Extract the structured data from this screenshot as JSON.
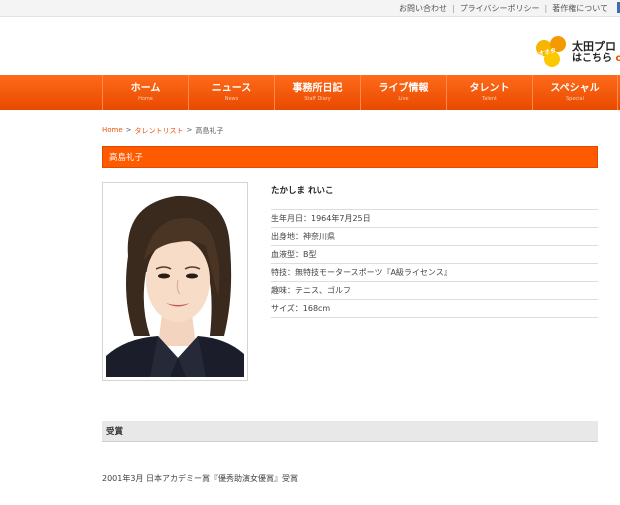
{
  "top_links": [
    "お問い合わせ",
    "プライバシーポリシー",
    "著作権について"
  ],
  "logo": {
    "mark_text": "オオタ",
    "line1": "太田プロ",
    "line2_main": "はこちら",
    "line2_accent": "oh"
  },
  "nav": [
    {
      "ja": "ホーム",
      "en": "Home"
    },
    {
      "ja": "ニュース",
      "en": "News"
    },
    {
      "ja": "事務所日記",
      "en": "Staff Diary"
    },
    {
      "ja": "ライブ情報",
      "en": "Live"
    },
    {
      "ja": "タレント",
      "en": "Talent"
    },
    {
      "ja": "スペシャル",
      "en": "Special"
    }
  ],
  "breadcrumb": {
    "home": "Home",
    "sep": ">",
    "list": "タレントリスト",
    "current": "高島礼子"
  },
  "title": "高島礼子",
  "profile": {
    "kana": "たかしま れいこ",
    "rows": [
      {
        "label": "生年月日：",
        "value": "1964年7月25日"
      },
      {
        "label": "出身地：",
        "value": "神奈川県"
      },
      {
        "label": "血液型：",
        "value": "B型"
      },
      {
        "label": "特技：",
        "value": "無特技モータースポーツ『A級ライセンス』"
      },
      {
        "label": "趣味：",
        "value": "テニス、ゴルフ"
      },
      {
        "label": "サイズ：",
        "value": "168cm"
      }
    ]
  },
  "awards_heading": "受賞",
  "awards": [
    "2001年3月 日本アカデミー賞『優秀助演女優賞』受賞"
  ],
  "colors": {
    "accent": "#ff5a00",
    "nav": "#e84a00",
    "link": "#e8540e"
  }
}
